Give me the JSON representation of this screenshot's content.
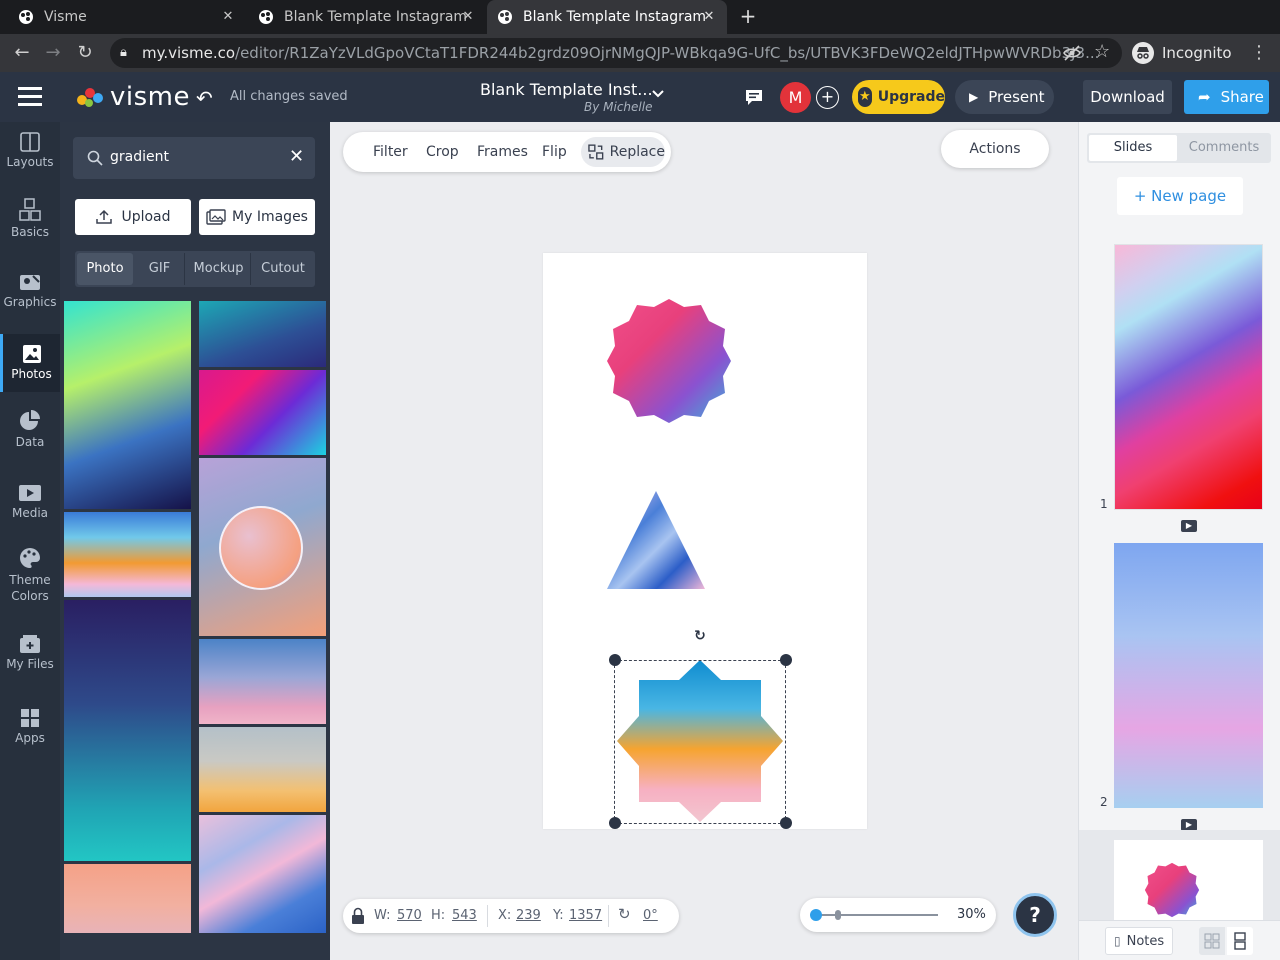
{
  "browser": {
    "tabs": [
      {
        "title": "Visme"
      },
      {
        "title": "Blank Template Instagram"
      },
      {
        "title": "Blank Template Instagram"
      }
    ],
    "url_main": "my.visme.co",
    "url_rest": "/editor/R1ZaYzVLdGpoVCtaT1FDR244b2grdz09OjrNMgQJP-WBkqa9G-UfC_bs/UTBVK3FDeWQ2eldJTHpwWVRDb3J3...",
    "incognito_label": "Incognito"
  },
  "app": {
    "logo_text": "visme",
    "save_status": "All changes saved",
    "project_title": "Blank Template Inst...",
    "project_author": "By Michelle",
    "avatar_letter": "M",
    "upgrade_label": "Upgrade",
    "present_label": "Present",
    "download_label": "Download",
    "share_label": "Share"
  },
  "leftnav": {
    "items": [
      {
        "label": "Layouts"
      },
      {
        "label": "Basics"
      },
      {
        "label": "Graphics"
      },
      {
        "label": "Photos"
      },
      {
        "label": "Data"
      },
      {
        "label": "Media"
      },
      {
        "label": "Theme Colors"
      },
      {
        "label": "My Files"
      },
      {
        "label": "Apps"
      }
    ]
  },
  "panel": {
    "search_value": "gradient",
    "upload_label": "Upload",
    "myimages_label": "My Images",
    "filter_tabs": [
      {
        "label": "Photo"
      },
      {
        "label": "GIF"
      },
      {
        "label": "Mockup"
      },
      {
        "label": "Cutout"
      }
    ]
  },
  "toolbar": {
    "filter": "Filter",
    "crop": "Crop",
    "frames": "Frames",
    "flip": "Flip",
    "replace": "Replace",
    "actions": "Actions"
  },
  "props": {
    "w_label": "W:",
    "w_value": "570",
    "h_label": "H:",
    "h_value": "543",
    "x_label": "X:",
    "x_value": "239",
    "y_label": "Y:",
    "y_value": "1357",
    "rotation": "0°"
  },
  "zoom": {
    "value": "30%",
    "level": 0.3,
    "help": "?"
  },
  "rightpanel": {
    "tab_slides": "Slides",
    "tab_comments": "Comments",
    "new_page": "+ New page",
    "slide_numbers": [
      "1",
      "2"
    ],
    "notes_label": "Notes"
  }
}
